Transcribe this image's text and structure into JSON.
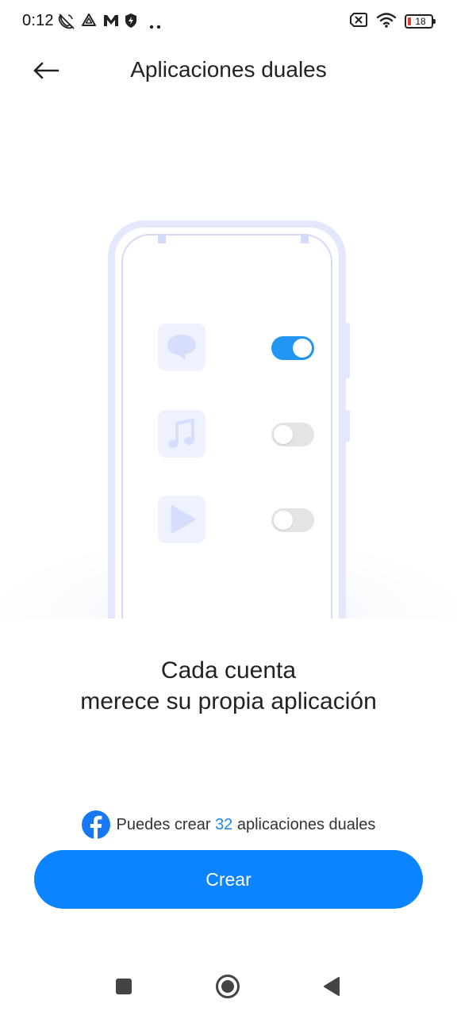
{
  "status_bar": {
    "time": "0:12",
    "battery_level": "18",
    "icons": [
      "call-muted-icon",
      "alert-triangle-icon",
      "m-app-icon",
      "shield-bolt-icon",
      "more-dots-icon",
      "sim-off-icon",
      "wifi-icon",
      "battery-icon"
    ]
  },
  "header": {
    "title": "Aplicaciones duales",
    "back_icon": "arrow-left-icon"
  },
  "illustration": {
    "rows": [
      {
        "icon": "chat-bubble-icon",
        "toggle": true
      },
      {
        "icon": "music-note-icon",
        "toggle": false
      },
      {
        "icon": "play-icon",
        "toggle": false
      }
    ]
  },
  "tagline": {
    "line1": "Cada cuenta",
    "line2": "merece su propia aplicación"
  },
  "info": {
    "icon": "facebook-icon",
    "prefix": "Puedes crear ",
    "count": "32",
    "suffix": " aplicaciones duales"
  },
  "create_button": {
    "label": "Crear"
  },
  "nav_bar": {
    "buttons": [
      "recents-square-icon",
      "home-circle-icon",
      "back-triangle-icon"
    ]
  },
  "colors": {
    "accent": "#0d84ff",
    "count_text": "#1e88e5",
    "toggle_on": "#2196f3",
    "illustration_frame": "#e3e8fc",
    "facebook": "#1877f2"
  }
}
